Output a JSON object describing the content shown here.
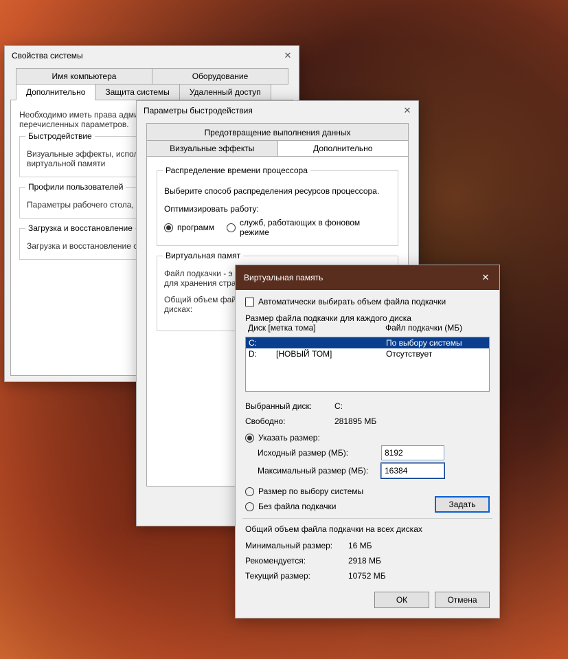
{
  "win1": {
    "title": "Свойства системы",
    "tabs_row1": [
      "Имя компьютера",
      "Оборудование"
    ],
    "tabs_row2": [
      "Дополнительно",
      "Защита системы",
      "Удаленный доступ"
    ],
    "admin_note": "Необходимо иметь права администратора для изменения большинства перечисленных параметров.",
    "group_perf_title": "Быстродействие",
    "group_perf_text": "Визуальные эффекты, использование процессора, оперативной и виртуальной памяти",
    "group_profiles_title": "Профили пользователей",
    "group_profiles_text": "Параметры рабочего стола, относящиеся ко входу в систему",
    "group_boot_title": "Загрузка и восстановление",
    "group_boot_text": "Загрузка и восстановление системы, отладочная информация"
  },
  "win2": {
    "title": "Параметры быстродействия",
    "top_tab": "Предотвращение выполнения данных",
    "tab_visual": "Визуальные эффекты",
    "tab_advanced": "Дополнительно",
    "cpu_group_title": "Распределение времени процессора",
    "cpu_note": "Выберите способ распределения ресурсов процессора.",
    "optimize_label": "Оптимизировать работу:",
    "radio_programs": "программ",
    "radio_services": "служб, работающих в фоновом режиме",
    "vm_group_title": "Виртуальная память",
    "vm_text1": "Файл подкачки - это область на жестком диске, используемая для хранения страниц виртуальной памяти.",
    "vm_text2": "Общий объем файла подкачки на всех дисках:"
  },
  "win3": {
    "title": "Виртуальная память",
    "auto_checkbox": "Автоматически выбирать объем файла подкачки",
    "size_header": "Размер файла подкачки для каждого диска",
    "col_disk": "Диск [метка тома]",
    "col_pagefile": "Файл подкачки (МБ)",
    "drives": [
      {
        "letter": "C:",
        "label": "",
        "pagefile": "По выбору системы",
        "selected": true
      },
      {
        "letter": "D:",
        "label": "[НОВЫЙ ТОМ]",
        "pagefile": "Отсутствует",
        "selected": false
      }
    ],
    "selected_drive_label": "Выбранный диск:",
    "selected_drive_value": "C:",
    "free_label": "Свободно:",
    "free_value": "281895 МБ",
    "radio_custom": "Указать размер:",
    "initial_label": "Исходный размер (МБ):",
    "initial_value": "8192",
    "max_label": "Максимальный размер (МБ):",
    "max_value": "16384",
    "radio_system": "Размер по выбору системы",
    "radio_none": "Без файла подкачки",
    "set_btn": "Задать",
    "total_header": "Общий объем файла подкачки на всех дисках",
    "min_label": "Минимальный размер:",
    "min_value": "16 МБ",
    "rec_label": "Рекомендуется:",
    "rec_value": "2918 МБ",
    "cur_label": "Текущий размер:",
    "cur_value": "10752 МБ",
    "ok": "ОК",
    "cancel": "Отмена"
  }
}
